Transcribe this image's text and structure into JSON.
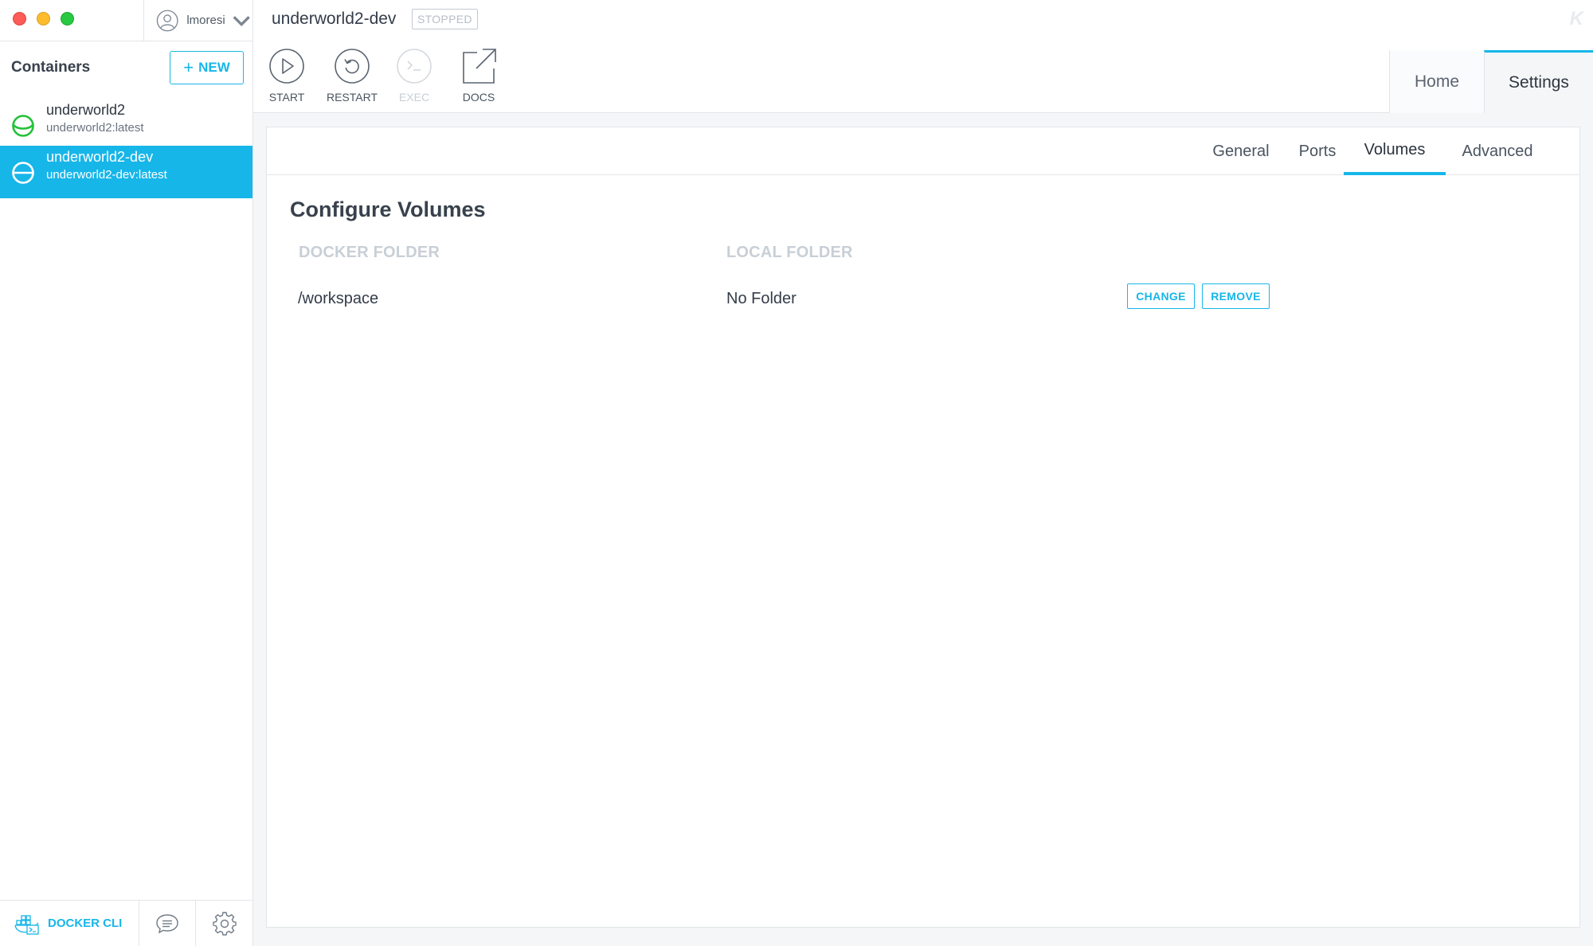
{
  "window": {
    "user": {
      "name": "lmoresi"
    }
  },
  "sidebar": {
    "title": "Containers",
    "new_button_label": "NEW",
    "containers": [
      {
        "name": "underworld2",
        "image": "underworld2:latest",
        "status": "running",
        "status_color": "#24c137"
      },
      {
        "name": "underworld2-dev",
        "image": "underworld2-dev:latest",
        "status": "stopped",
        "selected": true
      }
    ],
    "bottom": {
      "docker_cli_label": "DOCKER CLI"
    }
  },
  "header": {
    "container_name": "underworld2-dev",
    "state_badge": "STOPPED",
    "logo": "K",
    "actions": [
      {
        "label": "START",
        "icon": "play-icon",
        "enabled": true
      },
      {
        "label": "RESTART",
        "icon": "restart-icon",
        "enabled": true
      },
      {
        "label": "EXEC",
        "icon": "terminal-icon",
        "enabled": false
      },
      {
        "label": "DOCS",
        "icon": "external-link-icon",
        "enabled": true
      }
    ],
    "mode_tabs": [
      {
        "label": "Home",
        "active": false
      },
      {
        "label": "Settings",
        "active": true
      }
    ]
  },
  "settings": {
    "tabs": [
      {
        "label": "General",
        "active": false
      },
      {
        "label": "Ports",
        "active": false
      },
      {
        "label": "Volumes",
        "active": true
      },
      {
        "label": "Advanced",
        "active": false
      }
    ],
    "volumes": {
      "title": "Configure Volumes",
      "col_docker": "DOCKER FOLDER",
      "col_local": "LOCAL FOLDER",
      "rows": [
        {
          "docker_folder": "/workspace",
          "local_folder": "No Folder",
          "change_label": "CHANGE",
          "remove_label": "REMOVE"
        }
      ]
    }
  },
  "colors": {
    "accent": "#17b6e9",
    "running": "#24c137"
  }
}
